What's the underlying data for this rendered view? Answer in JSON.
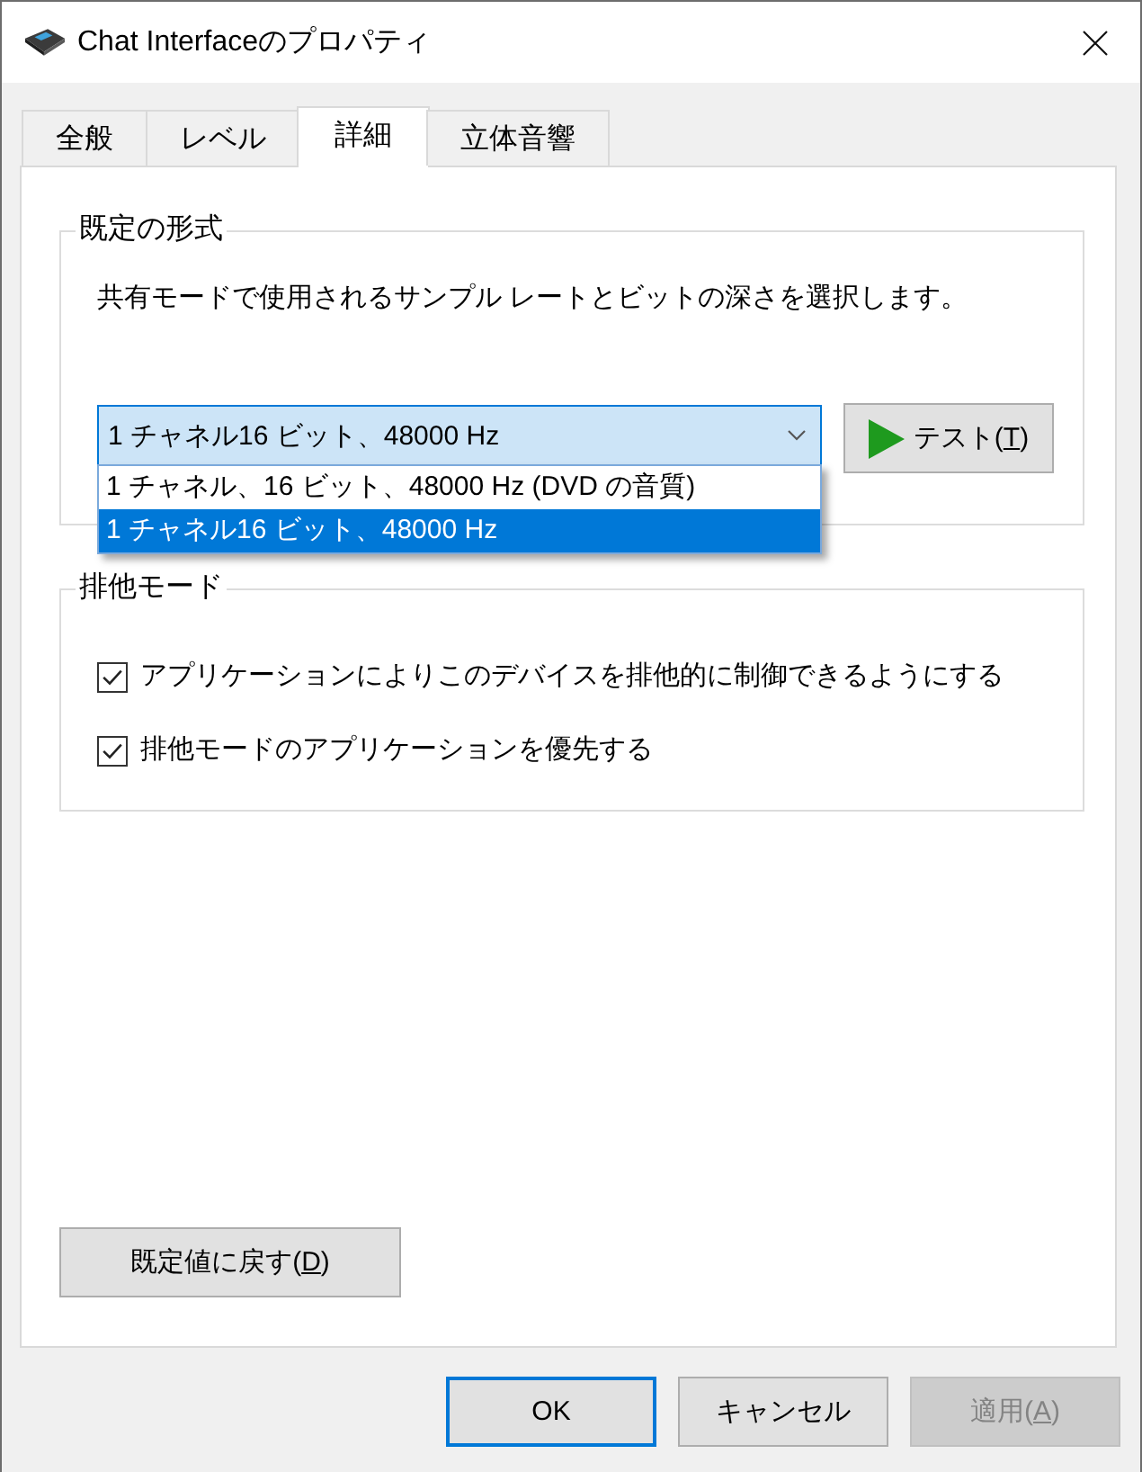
{
  "window": {
    "title": "Chat Interfaceのプロパティ"
  },
  "tabs": [
    {
      "label": "全般",
      "selected": false
    },
    {
      "label": "レベル",
      "selected": false
    },
    {
      "label": "詳細",
      "selected": true
    },
    {
      "label": "立体音響",
      "selected": false
    }
  ],
  "default_format": {
    "title": "既定の形式",
    "description": "共有モードで使用されるサンプル レートとビットの深さを選択します。",
    "format_dropdown": {
      "value": "1 チャネル16 ビット、48000 Hz",
      "expanded": true,
      "options": [
        {
          "label": "1 チャネル、16 ビット、48000 Hz (DVD の音質)",
          "selected": false
        },
        {
          "label": "1 チャネル16 ビット、48000 Hz",
          "selected": true
        }
      ]
    },
    "test_button": {
      "label_parts": [
        {
          "text": "テスト(",
          "underlined": false
        },
        {
          "text": "T",
          "underlined": true
        },
        {
          "text": ")",
          "underlined": false
        }
      ]
    }
  },
  "exclusive_mode": {
    "title": "排他モード",
    "options": [
      {
        "label": "アプリケーションによりこのデバイスを排他的に制御できるようにする",
        "checked": true
      },
      {
        "label": "排他モードのアプリケーションを優先する",
        "checked": true
      }
    ]
  },
  "restore_defaults_button": {
    "label_parts": [
      {
        "text": "既定値に戻す(",
        "underlined": false
      },
      {
        "text": "D",
        "underlined": true
      },
      {
        "text": ")",
        "underlined": false
      }
    ]
  },
  "buttons": [
    {
      "label_parts": [
        {
          "text": "OK",
          "underlined": false
        }
      ],
      "default": true,
      "disabled": false
    },
    {
      "label_parts": [
        {
          "text": "キャンセル",
          "underlined": false
        }
      ],
      "default": false,
      "disabled": false
    },
    {
      "label_parts": [
        {
          "text": "適用(",
          "underlined": false
        },
        {
          "text": "A",
          "underlined": true
        },
        {
          "text": ")",
          "underlined": false
        }
      ],
      "default": false,
      "disabled": true
    }
  ]
}
